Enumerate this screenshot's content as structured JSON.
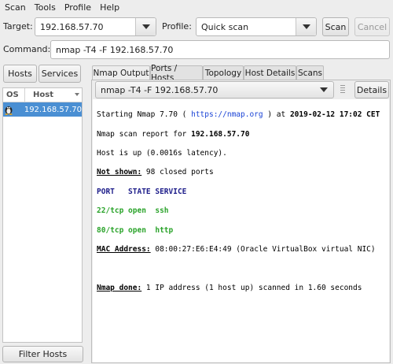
{
  "menu": [
    "Scan",
    "Tools",
    "Profile",
    "Help"
  ],
  "toolbar": {
    "target_label": "Target:",
    "target_value": "192.168.57.70",
    "profile_label": "Profile:",
    "profile_value": "Quick scan",
    "scan_label": "Scan",
    "cancel_label": "Cancel"
  },
  "command": {
    "label": "Command:",
    "value": "nmap -T4 -F 192.168.57.70"
  },
  "left": {
    "hosts_button": "Hosts",
    "services_button": "Services",
    "columns": [
      "OS",
      "Host"
    ],
    "hosts": [
      {
        "os_icon": "linux-penguin-icon",
        "host": "192.168.57.70"
      }
    ],
    "filter_button": "Filter Hosts"
  },
  "tabs": [
    "Nmap Output",
    "Ports / Hosts",
    "Topology",
    "Host Details",
    "Scans"
  ],
  "output_panel": {
    "select_value": "nmap -T4 -F 192.168.57.70",
    "details_button": "Details",
    "lines": {
      "l1a": "Starting Nmap 7.70 ( ",
      "l1link": "https://nmap.org",
      "l1b": " ) at ",
      "l1date": "2019-02-12 17:02 CET",
      "l2a": "Nmap scan report for ",
      "l2b": "192.168.57.70",
      "l3": "Host is up (0.0016s latency).",
      "l4a": "Not shown:",
      "l4b": " 98 closed ports",
      "l5": "PORT   STATE SERVICE",
      "l6": "22/tcp open  ssh",
      "l7": "80/tcp open  http",
      "l8a": "MAC Address:",
      "l8b": " 08:00:27:E6:E4:49 (Oracle VirtualBox virtual NIC)",
      "l9a": "Nmap done:",
      "l9b": " 1 IP address (1 host up) scanned in 1.60 seconds"
    }
  }
}
